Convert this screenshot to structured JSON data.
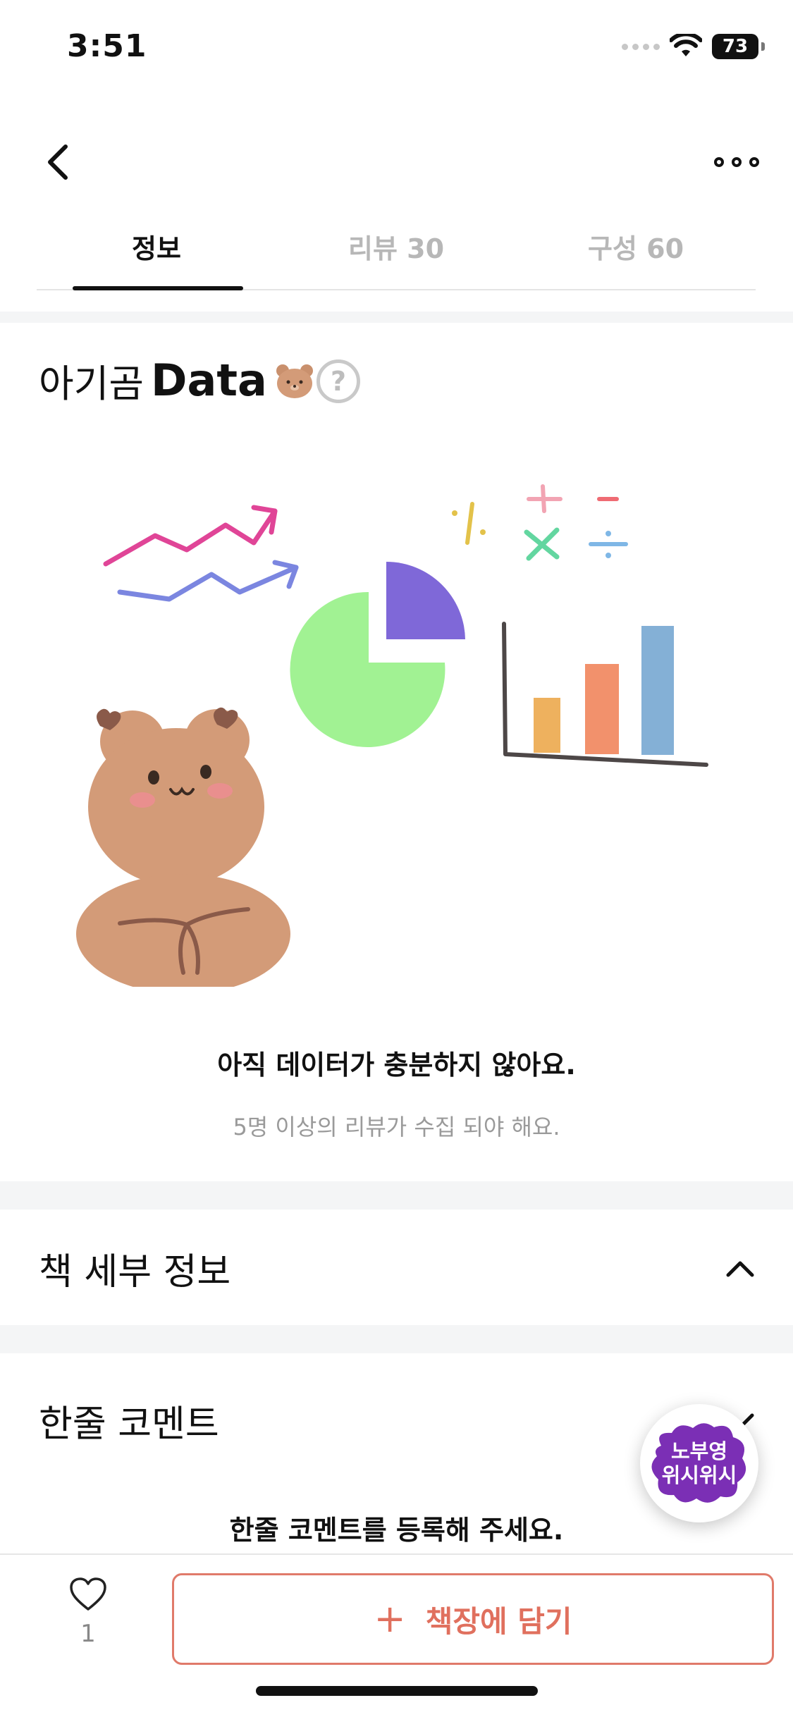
{
  "status_bar": {
    "time": "3:51",
    "battery": "73"
  },
  "tabs": [
    {
      "label": "정보",
      "active": true
    },
    {
      "label": "리뷰 30",
      "active": false
    },
    {
      "label": "구성 60",
      "active": false
    }
  ],
  "data_section": {
    "title_ko": "아기곰",
    "title_en": "Data",
    "help_symbol": "?",
    "empty_title": "아직 데이터가 충분하지 않아요.",
    "empty_subtitle": "5명 이상의 리뷰가 수집 되야 해요."
  },
  "book_details": {
    "title": "책 세부 정보"
  },
  "one_line_comment": {
    "title": "한줄 코멘트",
    "empty_message": "한줄 코멘트를 등록해 주세요."
  },
  "fab": {
    "line1": "노부영",
    "line2": "위시위시"
  },
  "bottom_bar": {
    "like_count": "1",
    "shelf_button_plus": "+",
    "shelf_button_label": "책장에 담기"
  },
  "colors": {
    "accent": "#e0705e",
    "fab_purple": "#7b2fb5",
    "tab_inactive": "#b7b7b7",
    "section_gap": "#f4f5f6"
  },
  "icons": [
    "back-arrow-icon",
    "more-dots-icon",
    "bear-face-icon",
    "help-icon",
    "chevron-up-icon",
    "chevron-down-icon",
    "heart-icon",
    "plus-icon"
  ]
}
